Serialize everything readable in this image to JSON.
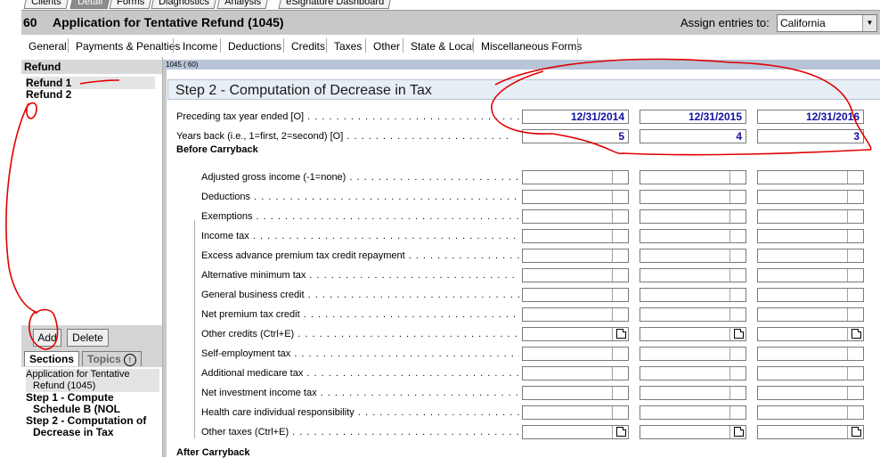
{
  "top_tabs": [
    "Clients",
    "Detail",
    "Forms",
    "Diagnostics",
    "Analysis",
    "eSignature Dashboard"
  ],
  "active_top_tab": "Detail",
  "header": {
    "form_number": "60",
    "form_title": "Application for Tentative Refund (1045)",
    "assign_label": "Assign entries to:",
    "assign_value": "California"
  },
  "categories": [
    "General",
    "Payments & Penalties",
    "Income",
    "Deductions",
    "Credits",
    "Taxes",
    "Other",
    "State & Local",
    "Miscellaneous Forms"
  ],
  "left_panel": {
    "header": "Refund",
    "items": [
      "Refund 1",
      "Refund 2"
    ],
    "add_label": "Add",
    "delete_label": "Delete",
    "tab_sections": "Sections",
    "tab_topics": "Topics",
    "sections": [
      {
        "line1": "Application for Tentative",
        "line2": "Refund (1045)"
      },
      {
        "line1": "Step 1 - Compute",
        "line2": "Schedule B (NOL"
      },
      {
        "line1": "Step 2 - Computation of",
        "line2": "Decrease in Tax"
      }
    ]
  },
  "main": {
    "form_strip": "1045 ( 60)",
    "step_title": "Step 2 - Computation of Decrease in Tax",
    "preceding_label": "Preceding tax year ended [O]",
    "years_back_label": "Years back (i.e., 1=first, 2=second) [O]",
    "before_carryback": "Before Carryback",
    "after_carryback": "After Carryback",
    "years": [
      "12/31/2014",
      "12/31/2015",
      "12/31/2016"
    ],
    "years_back": [
      "5",
      "4",
      "3"
    ],
    "rows": [
      {
        "label": "Adjusted gross income (-1=none)",
        "note": false
      },
      {
        "label": "Deductions",
        "note": false
      },
      {
        "label": "Exemptions",
        "note": false
      },
      {
        "label": "Income tax",
        "note": false
      },
      {
        "label": "Excess advance premium tax credit repayment",
        "note": false
      },
      {
        "label": "Alternative minimum tax",
        "note": false
      },
      {
        "label": "General business credit",
        "note": false
      },
      {
        "label": "Net premium tax credit",
        "note": false
      },
      {
        "label": "Other credits (Ctrl+E)",
        "note": true
      },
      {
        "label": "Self-employment tax",
        "note": false
      },
      {
        "label": "Additional medicare tax",
        "note": false
      },
      {
        "label": "Net investment income tax",
        "note": false
      },
      {
        "label": "Health care individual responsibility",
        "note": false
      },
      {
        "label": "Other taxes (Ctrl+E)",
        "note": true
      }
    ]
  },
  "colors": {
    "value_text": "#1010a0",
    "annotation": "#e00000"
  }
}
